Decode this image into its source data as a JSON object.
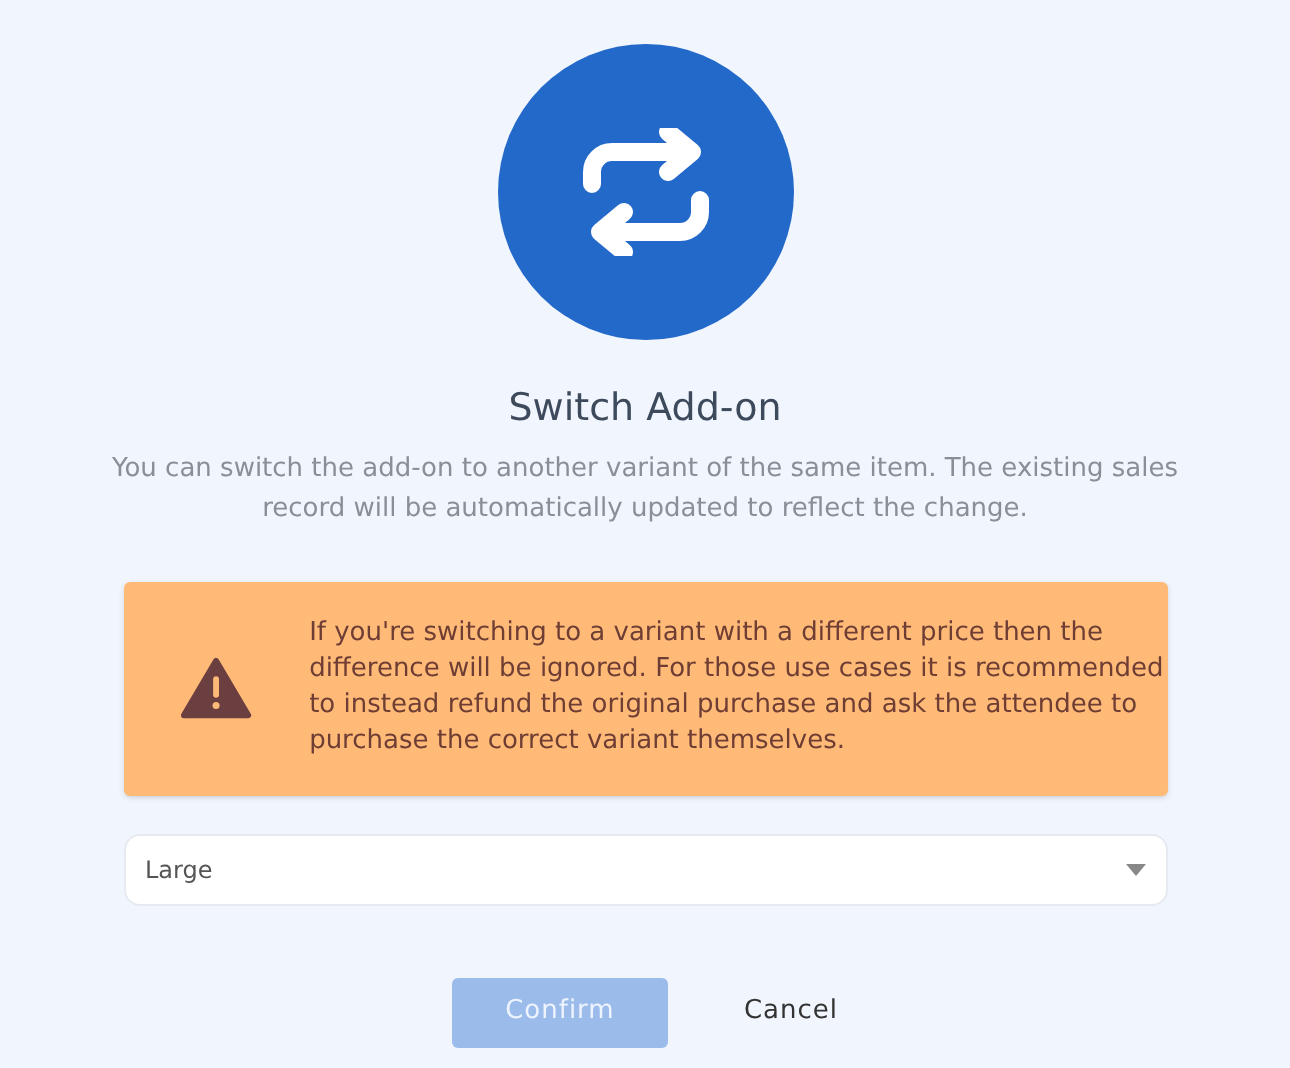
{
  "title": "Switch Add-on",
  "description": "You can switch the add-on to another variant of the same item. The existing sales record will be automatically updated to reflect the change.",
  "warning": {
    "text": "If you're switching to a variant with a different price then the difference will be ignored. For those use cases it is recommended to instead refund the original purchase and ask the attendee to purchase the correct variant themselves."
  },
  "variant_select": {
    "value": "Large"
  },
  "buttons": [
    {
      "kind": "primary",
      "label": "Confirm",
      "disabled": true
    },
    {
      "kind": "text",
      "label": "Cancel",
      "disabled": false
    }
  ]
}
